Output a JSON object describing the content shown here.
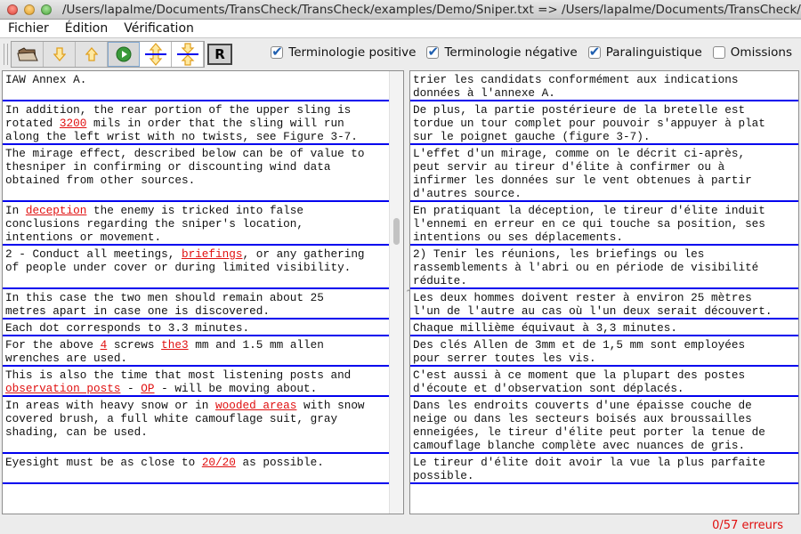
{
  "window": {
    "title": "/Users/lapalme/Documents/TransCheck/TransCheck/examples/Demo/Sniper.txt => /Users/lapalme/Documents/TransCheck/..."
  },
  "menu": [
    "Fichier",
    "Édition",
    "Vérification"
  ],
  "toolbar": {
    "buttons": [
      {
        "name": "open-folder",
        "icon": "folder-icon"
      },
      {
        "name": "next-error",
        "icon": "arrow-down-icon"
      },
      {
        "name": "previous-error",
        "icon": "arrow-up-icon"
      },
      {
        "name": "run-check",
        "icon": "play-icon"
      },
      {
        "name": "expand-rows",
        "icon": "expand-icon"
      },
      {
        "name": "collapse-rows",
        "icon": "collapse-icon"
      }
    ],
    "r_label": "R",
    "checkboxes": [
      {
        "label": "Terminologie positive",
        "checked": true
      },
      {
        "label": "Terminologie négative",
        "checked": true
      },
      {
        "label": "Paralinguistique",
        "checked": true
      },
      {
        "label": "Omissions",
        "checked": false
      }
    ]
  },
  "rows": [
    {
      "source": [
        [
          {
            "t": "IAW Annex A."
          }
        ],
        [
          {
            "t": ""
          }
        ]
      ],
      "target": [
        [
          {
            "t": "trier les candidats conformément aux indications"
          }
        ],
        [
          {
            "t": "données à l'annexe A."
          }
        ]
      ]
    },
    {
      "source": [
        [
          {
            "t": "In addition, the rear portion of the upper sling is"
          }
        ],
        [
          {
            "t": "rotated "
          },
          {
            "t": "3200",
            "err": true
          },
          {
            "t": " mils in order that the sling will run"
          }
        ],
        [
          {
            "t": "along the left wrist with no twists, see Figure 3-7."
          }
        ]
      ],
      "target": [
        [
          {
            "t": "De plus, la partie postérieure de la bretelle est"
          }
        ],
        [
          {
            "t": "tordue un tour complet pour pouvoir s'appuyer à plat"
          }
        ],
        [
          {
            "t": "sur le poignet gauche (figure 3-7)."
          }
        ]
      ]
    },
    {
      "source": [
        [
          {
            "t": "The mirage effect, described below can be of value to"
          }
        ],
        [
          {
            "t": "thesniper in confirming or discounting wind data"
          }
        ],
        [
          {
            "t": "obtained from other sources."
          }
        ],
        [
          {
            "t": ""
          }
        ]
      ],
      "target": [
        [
          {
            "t": "L'effet d'un mirage, comme on le décrit ci-après,"
          }
        ],
        [
          {
            "t": "peut servir au tireur d'élite à confirmer ou à"
          }
        ],
        [
          {
            "t": "infirmer les données sur le vent obtenues à partir"
          }
        ],
        [
          {
            "t": "d'autres source."
          }
        ]
      ]
    },
    {
      "source": [
        [
          {
            "t": "In "
          },
          {
            "t": "deception",
            "err": true
          },
          {
            "t": " the enemy is tricked into false"
          }
        ],
        [
          {
            "t": "conclusions regarding the sniper's location,"
          }
        ],
        [
          {
            "t": "intentions or movement."
          }
        ]
      ],
      "target": [
        [
          {
            "t": "En pratiquant la déception, le tireur d'élite induit"
          }
        ],
        [
          {
            "t": "l'ennemi en erreur en ce qui touche sa position, ses"
          }
        ],
        [
          {
            "t": "intentions ou ses déplacements."
          }
        ]
      ]
    },
    {
      "source": [
        [
          {
            "t": "2 - Conduct all meetings, "
          },
          {
            "t": "briefings",
            "err": true
          },
          {
            "t": ", or any gathering"
          }
        ],
        [
          {
            "t": "of people under cover or during limited visibility."
          }
        ],
        [
          {
            "t": ""
          }
        ]
      ],
      "target": [
        [
          {
            "t": "2) Tenir les réunions, les briefings ou les"
          }
        ],
        [
          {
            "t": "rassemblements à l'abri ou en période de visibilité"
          }
        ],
        [
          {
            "t": "réduite."
          }
        ]
      ]
    },
    {
      "source": [
        [
          {
            "t": "In this case the two men should remain about 25"
          }
        ],
        [
          {
            "t": "metres apart in case one is discovered."
          }
        ]
      ],
      "target": [
        [
          {
            "t": "Les deux hommes doivent rester à environ 25 mètres"
          }
        ],
        [
          {
            "t": "l'un de l'autre au cas où l'un deux serait découvert."
          }
        ]
      ]
    },
    {
      "source": [
        [
          {
            "t": "Each dot corresponds to 3.3 minutes."
          }
        ]
      ],
      "target": [
        [
          {
            "t": "Chaque millième équivaut à 3,3 minutes."
          }
        ]
      ]
    },
    {
      "source": [
        [
          {
            "t": "For the above "
          },
          {
            "t": "4",
            "err": true
          },
          {
            "t": " screws "
          },
          {
            "t": "the3",
            "err": true
          },
          {
            "t": " mm and 1.5 mm allen"
          }
        ],
        [
          {
            "t": "wrenches are used."
          }
        ]
      ],
      "target": [
        [
          {
            "t": "Des clés Allen de 3mm et de 1,5 mm sont employées"
          }
        ],
        [
          {
            "t": "pour serrer toutes les vis."
          }
        ]
      ]
    },
    {
      "source": [
        [
          {
            "t": "This is also the time that most listening posts and"
          }
        ],
        [
          {
            "t": "observation posts",
            "err": true
          },
          {
            "t": " - "
          },
          {
            "t": "OP",
            "err": true
          },
          {
            "t": " - will be moving about."
          }
        ]
      ],
      "target": [
        [
          {
            "t": "C'est aussi à ce moment que la plupart des postes"
          }
        ],
        [
          {
            "t": "d'écoute et d'observation sont déplacés."
          }
        ]
      ]
    },
    {
      "source": [
        [
          {
            "t": "In areas with heavy snow or in "
          },
          {
            "t": "wooded areas",
            "err": true
          },
          {
            "t": " with snow"
          }
        ],
        [
          {
            "t": "covered brush, a full white camouflage suit, gray"
          }
        ],
        [
          {
            "t": "shading, can be used."
          }
        ],
        [
          {
            "t": ""
          }
        ]
      ],
      "target": [
        [
          {
            "t": "Dans les endroits couverts d'une épaisse couche de"
          }
        ],
        [
          {
            "t": "neige ou dans les secteurs boisés aux broussailles"
          }
        ],
        [
          {
            "t": "enneigées, le tireur d'élite peut porter la tenue de"
          }
        ],
        [
          {
            "t": "camouflage blanche complète avec nuances de gris."
          }
        ]
      ]
    },
    {
      "source": [
        [
          {
            "t": "Eyesight must be as close to "
          },
          {
            "t": "20/20",
            "err": true
          },
          {
            "t": " as possible."
          }
        ],
        [
          {
            "t": ""
          }
        ]
      ],
      "target": [
        [
          {
            "t": "Le tireur d'élite doit avoir la vue la plus parfaite"
          }
        ],
        [
          {
            "t": "possible."
          }
        ]
      ]
    }
  ],
  "status": {
    "errors_text": "0/57 erreurs"
  },
  "colors": {
    "error": "#e01010",
    "separator": "#0000ee"
  }
}
